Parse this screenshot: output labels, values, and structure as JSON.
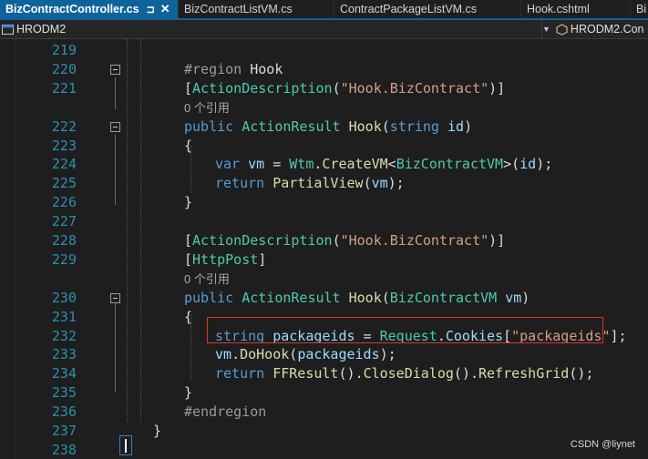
{
  "tabs": [
    {
      "label": "BizContractController.cs",
      "active": true
    },
    {
      "label": "BizContractListVM.cs"
    },
    {
      "label": "ContractPackageListVM.cs"
    },
    {
      "label": "Hook.cshtml"
    },
    {
      "label": "Bi"
    }
  ],
  "navbar": {
    "project": "HRODM2",
    "member": "HRODM2.Con"
  },
  "colors": {
    "accent": "#0e639c",
    "keyword": "#569cd6",
    "type": "#4ec9b0",
    "string": "#d69d85",
    "variable": "#9cdcfe",
    "method": "#dcdcaa",
    "line_number": "#2b91af",
    "highlight_border": "#e0312f"
  },
  "lines": [
    {
      "no": "219",
      "tokens": []
    },
    {
      "no": "220",
      "fold": true,
      "tokens": [
        [
          "pp",
          "#region "
        ],
        [
          "pn",
          "Hook"
        ]
      ]
    },
    {
      "no": "221",
      "tokens": [
        [
          "pn",
          "["
        ],
        [
          "ty",
          "ActionDescription"
        ],
        [
          "pn",
          "("
        ],
        [
          "st",
          "\"Hook.BizContract\""
        ],
        [
          "pn",
          ")]"
        ]
      ]
    },
    {
      "ref": "0 个引用"
    },
    {
      "no": "222",
      "fold": true,
      "tokens": [
        [
          "kw",
          "public "
        ],
        [
          "ty",
          "ActionResult "
        ],
        [
          "mt",
          "Hook"
        ],
        [
          "pn",
          "("
        ],
        [
          "kw",
          "string "
        ],
        [
          "vr",
          "id"
        ],
        [
          "pn",
          ")"
        ]
      ]
    },
    {
      "no": "223",
      "tokens": [
        [
          "pn",
          "{"
        ]
      ]
    },
    {
      "no": "224",
      "indent": 1,
      "tokens": [
        [
          "kw",
          "var "
        ],
        [
          "vr",
          "vm"
        ],
        [
          "pn",
          " = "
        ],
        [
          "ty",
          "Wtm"
        ],
        [
          "pn",
          "."
        ],
        [
          "mt",
          "CreateVM"
        ],
        [
          "pn",
          "<"
        ],
        [
          "ty",
          "BizContractVM"
        ],
        [
          "pn",
          ">("
        ],
        [
          "vr",
          "id"
        ],
        [
          "pn",
          ");"
        ]
      ]
    },
    {
      "no": "225",
      "indent": 1,
      "tokens": [
        [
          "kw",
          "return "
        ],
        [
          "mt",
          "PartialView"
        ],
        [
          "pn",
          "("
        ],
        [
          "vr",
          "vm"
        ],
        [
          "pn",
          ");"
        ]
      ]
    },
    {
      "no": "226",
      "tokens": [
        [
          "pn",
          "}"
        ]
      ]
    },
    {
      "no": "227",
      "tokens": []
    },
    {
      "no": "228",
      "tokens": [
        [
          "pn",
          "["
        ],
        [
          "ty",
          "ActionDescription"
        ],
        [
          "pn",
          "("
        ],
        [
          "st",
          "\"Hook.BizContract\""
        ],
        [
          "pn",
          ")]"
        ]
      ]
    },
    {
      "no": "229",
      "tokens": [
        [
          "pn",
          "["
        ],
        [
          "ty",
          "HttpPost"
        ],
        [
          "pn",
          "]"
        ]
      ]
    },
    {
      "ref": "0 个引用"
    },
    {
      "no": "230",
      "fold": true,
      "tokens": [
        [
          "kw",
          "public "
        ],
        [
          "ty",
          "ActionResult "
        ],
        [
          "mt",
          "Hook"
        ],
        [
          "pn",
          "("
        ],
        [
          "ty",
          "BizContractVM "
        ],
        [
          "vr",
          "vm"
        ],
        [
          "pn",
          ")"
        ]
      ]
    },
    {
      "no": "231",
      "tokens": [
        [
          "pn",
          "{"
        ]
      ]
    },
    {
      "no": "232",
      "indent": 1,
      "tokens": [
        [
          "kw",
          "string "
        ],
        [
          "vr",
          "packageids"
        ],
        [
          "pn",
          " = "
        ],
        [
          "ty",
          "Request"
        ],
        [
          "pn",
          "."
        ],
        [
          "vr",
          "Cookies"
        ],
        [
          "pn",
          "["
        ],
        [
          "st",
          "\"packageids\""
        ],
        [
          "pn",
          "];"
        ]
      ]
    },
    {
      "no": "233",
      "indent": 1,
      "tokens": [
        [
          "vr",
          "vm"
        ],
        [
          "pn",
          "."
        ],
        [
          "mt",
          "DoHook"
        ],
        [
          "pn",
          "("
        ],
        [
          "vr",
          "packageids"
        ],
        [
          "pn",
          ");"
        ]
      ]
    },
    {
      "no": "234",
      "indent": 1,
      "tokens": [
        [
          "kw",
          "return "
        ],
        [
          "mt",
          "FFResult"
        ],
        [
          "pn",
          "()."
        ],
        [
          "mt",
          "CloseDialog"
        ],
        [
          "pn",
          "()."
        ],
        [
          "mt",
          "RefreshGrid"
        ],
        [
          "pn",
          "();"
        ]
      ]
    },
    {
      "no": "235",
      "tokens": [
        [
          "pn",
          "}"
        ]
      ]
    },
    {
      "no": "236",
      "tokens": [
        [
          "pp",
          "#endregion"
        ]
      ]
    },
    {
      "no": "237",
      "outdent": true,
      "tokens": [
        [
          "pn",
          "}"
        ]
      ]
    },
    {
      "no": "238",
      "tokens": []
    }
  ],
  "watermark": "CSDN @liynet"
}
